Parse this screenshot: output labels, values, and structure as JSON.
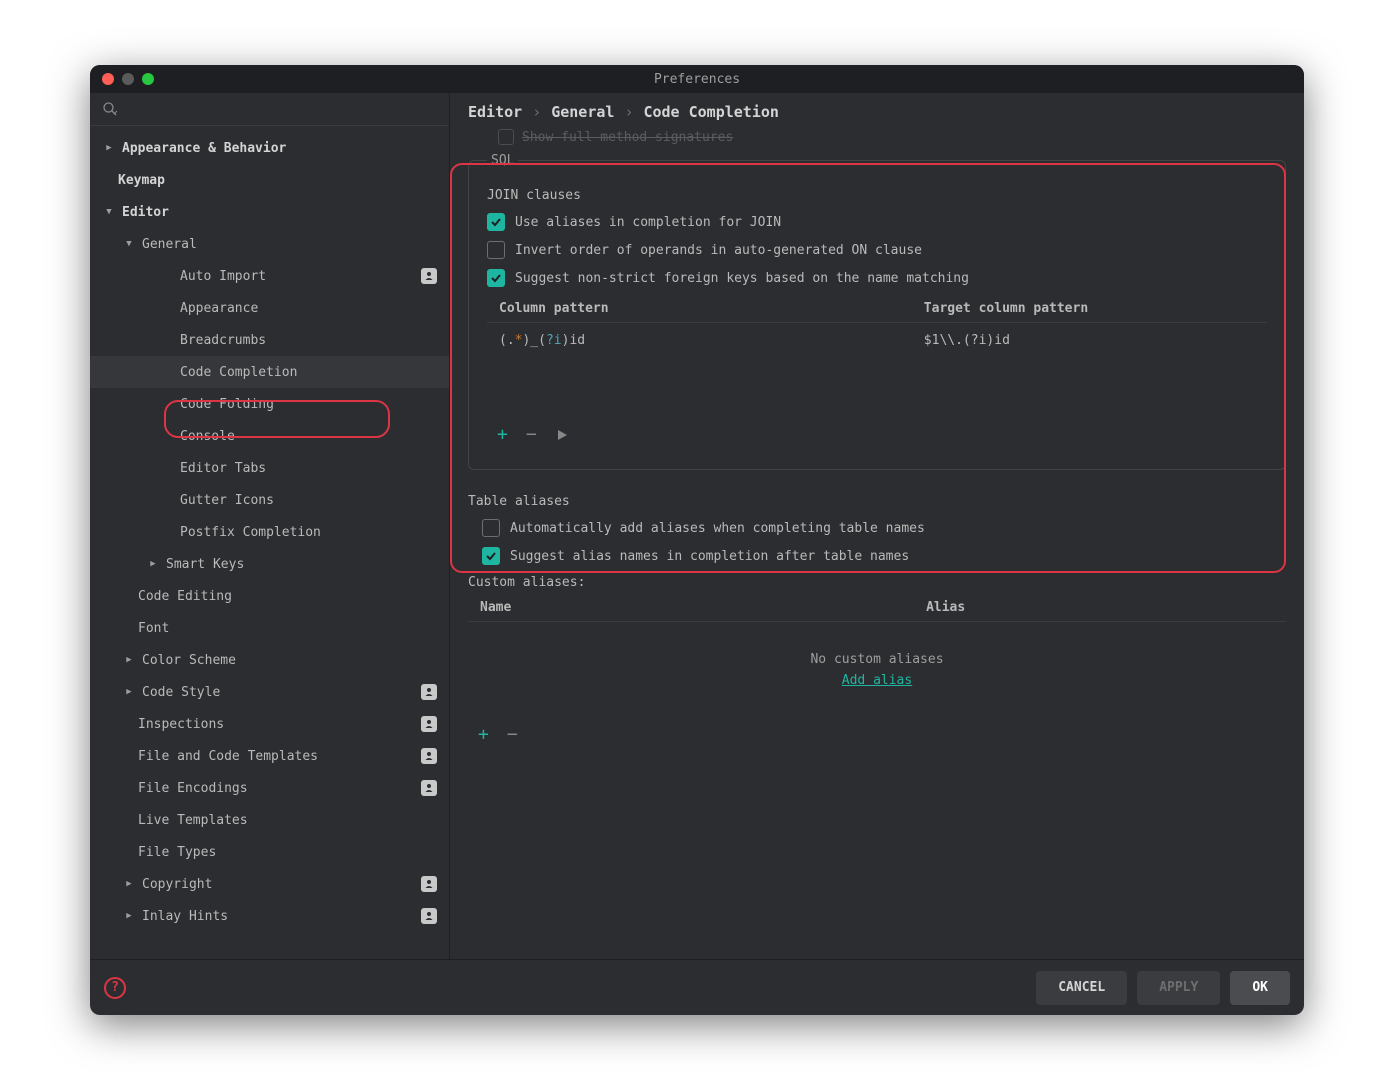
{
  "window": {
    "title": "Preferences"
  },
  "breadcrumb": {
    "p1": "Editor",
    "p2": "General",
    "p3": "Code Completion"
  },
  "faded": "Show full method signatures",
  "sidebar": {
    "items": [
      {
        "id": "appearance-behavior",
        "label": "Appearance & Behavior",
        "level": 0,
        "arrow": "right",
        "top": true
      },
      {
        "id": "keymap",
        "label": "Keymap",
        "level": 0,
        "top": true
      },
      {
        "id": "editor",
        "label": "Editor",
        "level": 0,
        "arrow": "down",
        "top": true
      },
      {
        "id": "general",
        "label": "General",
        "level": 1,
        "arrow": "down"
      },
      {
        "id": "auto-import",
        "label": "Auto Import",
        "level": 3,
        "badge": true
      },
      {
        "id": "gen-appearance",
        "label": "Appearance",
        "level": 3
      },
      {
        "id": "breadcrumbs",
        "label": "Breadcrumbs",
        "level": 3
      },
      {
        "id": "code-completion",
        "label": "Code Completion",
        "level": 3,
        "selected": true
      },
      {
        "id": "code-folding",
        "label": "Code Folding",
        "level": 3
      },
      {
        "id": "console",
        "label": "Console",
        "level": 3
      },
      {
        "id": "editor-tabs",
        "label": "Editor Tabs",
        "level": 3
      },
      {
        "id": "gutter-icons",
        "label": "Gutter Icons",
        "level": 3
      },
      {
        "id": "postfix-completion",
        "label": "Postfix Completion",
        "level": 3
      },
      {
        "id": "smart-keys",
        "label": "Smart Keys",
        "level": 2,
        "arrow": "right"
      },
      {
        "id": "code-editing",
        "label": "Code Editing",
        "level": 1
      },
      {
        "id": "font",
        "label": "Font",
        "level": 1
      },
      {
        "id": "color-scheme",
        "label": "Color Scheme",
        "level": 1,
        "arrow": "right",
        "arrowLevel": 1
      },
      {
        "id": "code-style",
        "label": "Code Style",
        "level": 1,
        "arrow": "right",
        "arrowLevel": 1,
        "badge": true
      },
      {
        "id": "inspections",
        "label": "Inspections",
        "level": 1,
        "badge": true
      },
      {
        "id": "file-templates",
        "label": "File and Code Templates",
        "level": 1,
        "badge": true
      },
      {
        "id": "file-encodings",
        "label": "File Encodings",
        "level": 1,
        "badge": true
      },
      {
        "id": "live-templates",
        "label": "Live Templates",
        "level": 1
      },
      {
        "id": "file-types",
        "label": "File Types",
        "level": 1
      },
      {
        "id": "copyright",
        "label": "Copyright",
        "level": 1,
        "arrow": "right",
        "arrowLevel": 1,
        "badge": true
      },
      {
        "id": "inlay-hints",
        "label": "Inlay Hints",
        "level": 1,
        "arrow": "right",
        "arrowLevel": 1,
        "badge": true
      }
    ]
  },
  "sql": {
    "legend": "SQL",
    "join_heading": "JOIN clauses",
    "chk_aliases": "Use aliases in completion for JOIN",
    "chk_invert": "Invert order of operands in auto-generated ON clause",
    "chk_suggest_fk": "Suggest non-strict foreign keys based on the name matching",
    "col_pattern": "Column pattern",
    "target_pattern": "Target column pattern",
    "row1_col": "(.*)_(?i)id",
    "row1_target": "$1\\\\.(?i)id"
  },
  "aliases": {
    "heading": "Table aliases",
    "chk_auto": "Automatically add aliases when completing table names",
    "chk_suggest": "Suggest alias names in completion after table names",
    "custom_heading": "Custom aliases:",
    "col_name": "Name",
    "col_alias": "Alias",
    "empty": "No custom aliases",
    "add_link": "Add alias"
  },
  "footer": {
    "cancel": "CANCEL",
    "apply": "APPLY",
    "ok": "OK"
  }
}
